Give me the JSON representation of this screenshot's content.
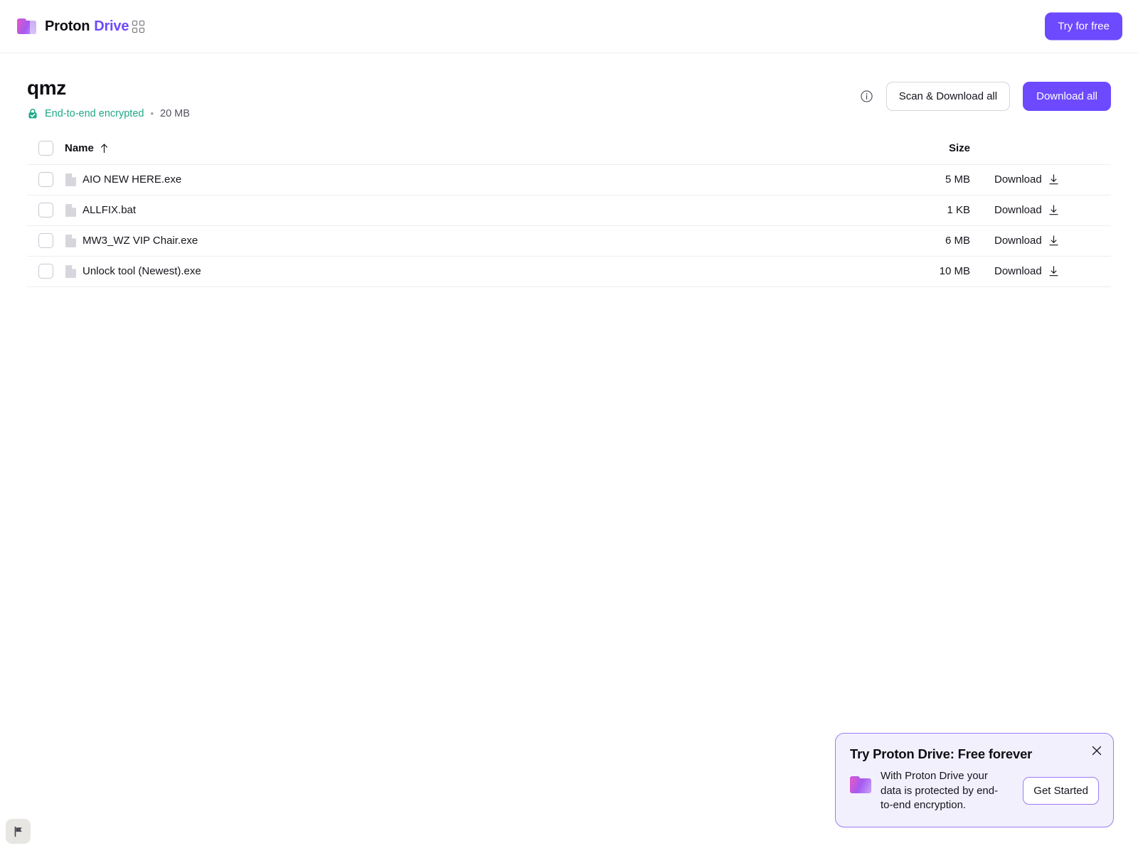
{
  "topbar": {
    "brand_word1": "Proton",
    "brand_word2": "Drive",
    "app_switcher_icon": "grid-2x2-icon",
    "logo_icon": "proton-drive-folder-logo",
    "try_for_free_label": "Try for free"
  },
  "header": {
    "title": "qmz",
    "encryption_icon": "lock-check-icon",
    "encryption_label": "End-to-end encrypted",
    "separator": "•",
    "total_size": "20 MB",
    "info_icon": "info-circle-icon",
    "scan_download_label": "Scan & Download all",
    "download_all_label": "Download all"
  },
  "table": {
    "columns": {
      "name": "Name",
      "size": "Size",
      "sort_icon": "arrow-up-icon"
    },
    "rows": [
      {
        "name": "AIO NEW HERE.exe",
        "size": "5 MB",
        "download_label": "Download",
        "file_icon": "file-icon",
        "download_icon": "download-arrow-icon"
      },
      {
        "name": "ALLFIX.bat",
        "size": "1 KB",
        "download_label": "Download",
        "file_icon": "file-icon",
        "download_icon": "download-arrow-icon"
      },
      {
        "name": "MW3_WZ VIP Chair.exe",
        "size": "6 MB",
        "download_label": "Download",
        "file_icon": "file-icon",
        "download_icon": "download-arrow-icon"
      },
      {
        "name": "Unlock tool (Newest).exe",
        "size": "10 MB",
        "download_label": "Download",
        "file_icon": "file-icon",
        "download_icon": "download-arrow-icon"
      }
    ]
  },
  "report": {
    "icon": "flag-icon"
  },
  "promo": {
    "title": "Try Proton Drive: Free forever",
    "body": "With Proton Drive your data is protected by end-to-end encryption.",
    "folder_icon": "proton-drive-folder-logo",
    "cta_label": "Get Started",
    "close_icon": "close-icon"
  },
  "colors": {
    "accent_purple": "#6d4aff",
    "encryption_green": "#1ea885",
    "promo_background": "#f3f0fe",
    "promo_border": "#9b7bf7",
    "divider": "#eeecf2"
  }
}
